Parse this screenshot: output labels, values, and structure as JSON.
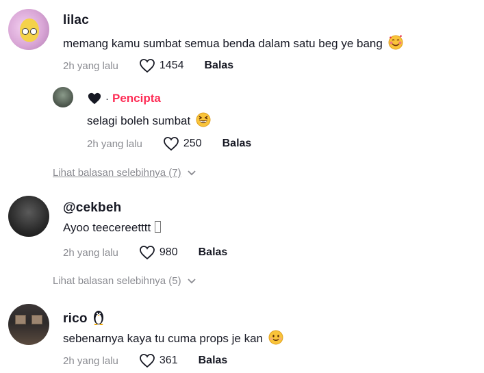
{
  "comments": [
    {
      "username": "lilac",
      "text": "memang kamu sumbat semua benda dalam satu beg ye bang",
      "emoji": "smiling-face-with-hearts",
      "time": "2h yang lalu",
      "likes": "1454",
      "reply_label": "Balas"
    },
    {
      "username": "@cekbeh",
      "text": "Ayoo teecereetttt",
      "time": "2h yang lalu",
      "likes": "980",
      "reply_label": "Balas"
    },
    {
      "username": "rico",
      "username_emoji": "penguin",
      "text": "sebenarnya kaya tu cuma props je kan",
      "emoji": "slightly-smiling-face",
      "time": "2h yang lalu",
      "likes": "361",
      "reply_label": "Balas"
    }
  ],
  "reply": {
    "creator_label": "Pencipta",
    "text": "selagi boleh sumbat",
    "emoji": "grinning-squinting-face",
    "time": "2h yang lalu",
    "likes": "250",
    "reply_label": "Balas"
  },
  "view_more": [
    {
      "label": "Lihat balasan selebihnya (7)"
    },
    {
      "label": "Lihat balasan selebihnya (5)"
    }
  ],
  "colors": {
    "creator": "#fe2c55",
    "muted": "#8a8b91",
    "text": "#161823"
  }
}
